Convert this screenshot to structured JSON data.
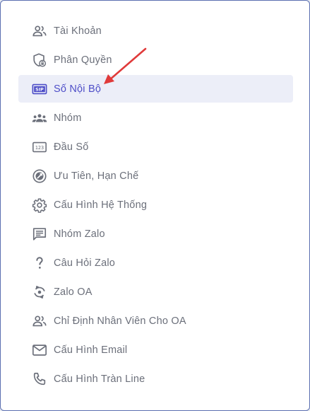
{
  "menu": {
    "items": [
      {
        "label": "Tài Khoản",
        "icon": "users-icon"
      },
      {
        "label": "Phân Quyền",
        "icon": "shield-lock-icon"
      },
      {
        "label": "Số Nội Bộ",
        "icon": "sip-icon",
        "active": true
      },
      {
        "label": "Nhóm",
        "icon": "group-icon"
      },
      {
        "label": "Đầu Số",
        "icon": "numeric-123-icon"
      },
      {
        "label": "Ưu Tiên, Hạn Chế",
        "icon": "priority-icon"
      },
      {
        "label": "Cấu Hình Hệ Thống",
        "icon": "gear-icon"
      },
      {
        "label": "Nhóm Zalo",
        "icon": "chat-icon"
      },
      {
        "label": "Câu Hỏi Zalo",
        "icon": "question-icon"
      },
      {
        "label": "Zalo OA",
        "icon": "refresh-icon"
      },
      {
        "label": "Chỉ Định Nhân Viên Cho OA",
        "icon": "users-icon"
      },
      {
        "label": "Cấu Hình Email",
        "icon": "email-icon"
      },
      {
        "label": "Cấu Hình Tràn Line",
        "icon": "phone-icon"
      }
    ]
  },
  "sip_badge": "SIP",
  "numeric_badge": "123",
  "colors": {
    "active_bg": "#eceef8",
    "active_text": "#4e4ec8",
    "text": "#6b6f7a",
    "arrow": "#e03a3a"
  }
}
